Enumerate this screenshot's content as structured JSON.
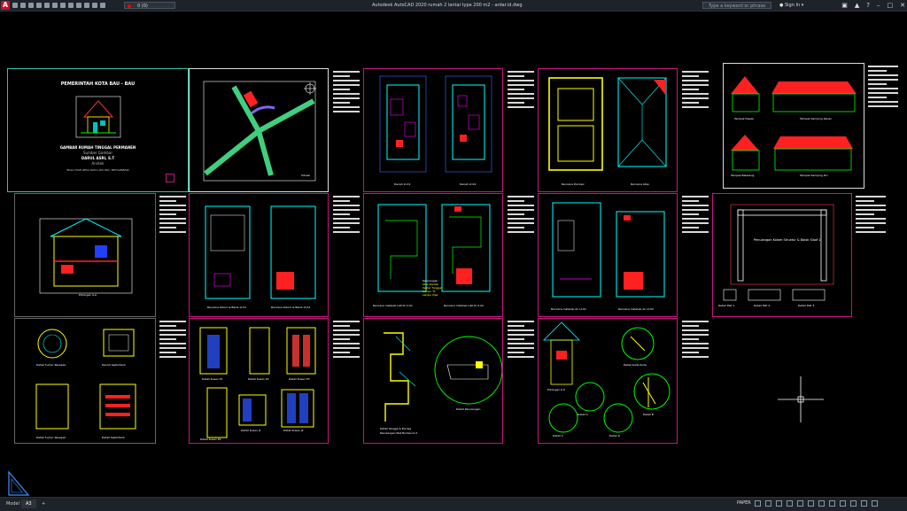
{
  "titlebar": {
    "app_logo": "A",
    "layer_value": "0 (0)",
    "title": "Autodesk AutoCAD 2020  rumah 2 lantai type 200 m2 - ardar.id.dwg",
    "search_placeholder": "Type a keyword or phrase",
    "sign_in": "Sign In",
    "icons": [
      "new-icon",
      "open-icon",
      "save-icon",
      "saveas-icon",
      "print-icon",
      "undo-icon",
      "redo-icon",
      "share-icon",
      "layer-icon",
      "user-icon",
      "cart-icon",
      "help-icon"
    ]
  },
  "sheets": {
    "cover": {
      "line1": "PEMERINTAH KOTA BAU - BAU",
      "line2": "GAMBAR RUMAH TINGGAL PERMANEN",
      "line3": "Sumber Gambar",
      "line4": "DARUL ASRI, S.T",
      "line5": "Arsitek",
      "line6": "BOLA FASE DESA RAYA LIPU KEC. BETOAMBARI"
    },
    "site": {
      "label": "Situasi"
    },
    "denah": [
      "Denah Lt.01",
      "Denah Lt.02"
    ],
    "rencana_atap": [
      "Rencana Pondasi",
      "Rencana Atap"
    ],
    "tampak": [
      "Tampak Depan",
      "Tampak Samping Kanan",
      "Tampak Belakang",
      "Tampak Samping Kiri"
    ],
    "potongan": "Potongan A-A",
    "rencana_kolom": [
      "Rencana Kolom & Balok Lt.01",
      "Rencana Kolom & Balok Lt.02"
    ],
    "instalasi_listrik": [
      "Rencana Instalasi Listrik Lt.01",
      "Rencana Instalasi Listrik Lt.02"
    ],
    "instalasi_air": [
      "Rencana Instalasi Air Lt.01",
      "Rencana Instalasi Air Lt.02"
    ],
    "portal": {
      "title": "Penulangan Kolom Struktur & Balok Sloof 1",
      "details": [
        "Detail Plat 1",
        "Detail Plat 2",
        "Detail Plat 3"
      ]
    },
    "septic": [
      "Detail Sumur Resapan",
      "Denah Septictank",
      "Detail Sumur Resapan",
      "Detail Septictank"
    ],
    "kusen": [
      "Detail Kusen P1",
      "Detail Kusen P2",
      "Detail Kusen P3",
      "Detail Kusen J1",
      "Detail Kusen J2",
      "Detail Kusen P4"
    ],
    "tangga": [
      "Detail Tangga & Bordes",
      "Penulangan Plat Bordes Lt.2",
      "Detail Penulangan"
    ],
    "kuda": [
      "Potongan K.K",
      "Detail Kuda-Kuda",
      "Detail A",
      "Detail B",
      "Detail C",
      "Detail D"
    ]
  },
  "legend": [
    "Keterangan :",
    "Stop Kontak",
    "Saklar Tunggal",
    "Lampu TL",
    "Lampu Pijar"
  ],
  "statusbar": {
    "tabs": [
      "Model",
      "A3",
      "+"
    ],
    "active_tab": "A3",
    "space": "PAPER"
  },
  "colors": {
    "accent": "#2ec2a6",
    "sheet_border": "#c9157f",
    "drawing_yellow": "#ffff00",
    "drawing_cyan": "#00ffff",
    "drawing_red": "#ff0000"
  }
}
